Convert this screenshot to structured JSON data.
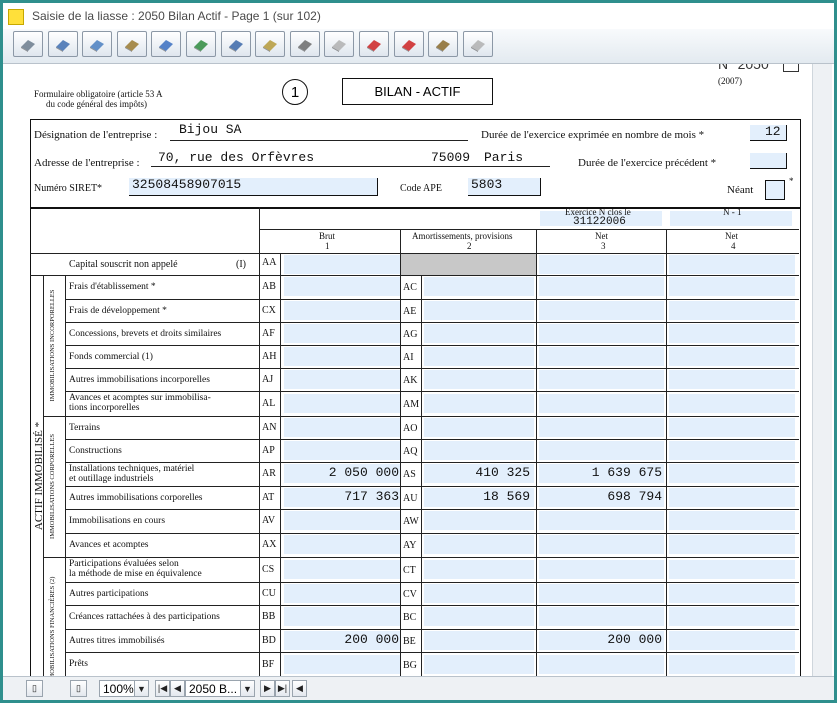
{
  "window": {
    "title": "Saisie de la liasse : 2050  Bilan Actif - Page 1 (sur 102)"
  },
  "toolbar": {
    "buttons": [
      {
        "name": "book-icon"
      },
      {
        "name": "pen-icon"
      },
      {
        "name": "search-people-icon"
      },
      {
        "name": "edit-icon"
      },
      {
        "name": "search-icon"
      },
      {
        "name": "check-icon"
      },
      {
        "name": "print-icon"
      },
      {
        "name": "open-book-icon"
      },
      {
        "name": "stack-icon"
      },
      {
        "name": "disabled-stack-icon"
      },
      {
        "name": "red-folder-icon"
      },
      {
        "name": "red-refresh-icon"
      },
      {
        "name": "printer-icon"
      },
      {
        "name": "disabled-tool-icon"
      }
    ]
  },
  "form": {
    "number_label": "N° 2050",
    "year": "(2007)",
    "note": "Formulaire obligatoire (article 53 A",
    "note2": "du code général des impôts)",
    "circle_number": "1",
    "title": "BILAN - ACTIF",
    "designation_label": "Désignation de l'entreprise :",
    "designation_value": "Bijou SA",
    "duree_label": "Durée de l'exercice exprimée en nombre de mois *",
    "duree_value": "12",
    "adresse_label": "Adresse de l'entreprise :",
    "adresse_value": "70, rue des Orfèvres",
    "cp_value": "75009",
    "ville_value": "Paris",
    "duree_prec_label": "Durée de l'exercice précédent *",
    "siret_label": "Numéro SIRET*",
    "siret_value": "32508458907015",
    "ape_label": "Code APE",
    "ape_value": "5803",
    "neant_label": "Néant",
    "neant_star": "*"
  },
  "table": {
    "exercice_label": "Exercice N clos le",
    "exercice_date": "31122006",
    "n1_label": "N - 1",
    "col_brut": "Brut",
    "col_brut_n": "1",
    "col_amort": "Amortissements, provisions",
    "col_amort_n": "2",
    "col_net": "Net",
    "col_net_n": "3",
    "col_net1": "Net",
    "col_net1_n": "4",
    "group_main": "ACTIF IMMOBILISÉ *",
    "group_incorp": "IMMOBILISATIONS INCORPORELLES",
    "group_corp": "IMMOBILISATIONS CORPORELLES",
    "group_fin": "IMMOBILISATIONS FINANCIÈRES (2)",
    "capital_label": "Capital souscrit non appelé",
    "capital_note": "(I)",
    "capital_code": "AA",
    "rows": [
      {
        "label": "Frais d'établissement *",
        "label2": "",
        "c1": "AB",
        "c2": "AC",
        "brut": "",
        "amort": "",
        "net": ""
      },
      {
        "label": "Frais de développement *",
        "label2": "",
        "c1": "CX",
        "c2": "AE",
        "brut": "",
        "amort": "",
        "net": ""
      },
      {
        "label": "Concessions, brevets et droits similaires",
        "label2": "",
        "c1": "AF",
        "c2": "AG",
        "brut": "",
        "amort": "",
        "net": ""
      },
      {
        "label": "Fonds commercial (1)",
        "label2": "",
        "c1": "AH",
        "c2": "AI",
        "brut": "",
        "amort": "",
        "net": ""
      },
      {
        "label": "Autres immobilisations incorporelles",
        "label2": "",
        "c1": "AJ",
        "c2": "AK",
        "brut": "",
        "amort": "",
        "net": ""
      },
      {
        "label": "Avances et acomptes sur immobilisa-",
        "label2": "tions incorporelles",
        "c1": "AL",
        "c2": "AM",
        "brut": "",
        "amort": "",
        "net": ""
      },
      {
        "label": "Terrains",
        "label2": "",
        "c1": "AN",
        "c2": "AO",
        "brut": "",
        "amort": "",
        "net": ""
      },
      {
        "label": "Constructions",
        "label2": "",
        "c1": "AP",
        "c2": "AQ",
        "brut": "",
        "amort": "",
        "net": ""
      },
      {
        "label": "Installations techniques, matériel",
        "label2": "et outillage industriels",
        "c1": "AR",
        "c2": "AS",
        "brut": "2 050 000",
        "amort": "410 325",
        "net": "1 639 675"
      },
      {
        "label": "Autres immobilisations corporelles",
        "label2": "",
        "c1": "AT",
        "c2": "AU",
        "brut": "717 363",
        "amort": "18 569",
        "net": "698 794"
      },
      {
        "label": "Immobilisations en cours",
        "label2": "",
        "c1": "AV",
        "c2": "AW",
        "brut": "",
        "amort": "",
        "net": ""
      },
      {
        "label": "Avances et acomptes",
        "label2": "",
        "c1": "AX",
        "c2": "AY",
        "brut": "",
        "amort": "",
        "net": ""
      },
      {
        "label": "Participations évaluées selon",
        "label2": "la méthode de mise en équivalence",
        "c1": "CS",
        "c2": "CT",
        "brut": "",
        "amort": "",
        "net": ""
      },
      {
        "label": "Autres participations",
        "label2": "",
        "c1": "CU",
        "c2": "CV",
        "brut": "",
        "amort": "",
        "net": ""
      },
      {
        "label": "Créances rattachées à des participations",
        "label2": "",
        "c1": "BB",
        "c2": "BC",
        "brut": "",
        "amort": "",
        "net": ""
      },
      {
        "label": "Autres titres immobilisés",
        "label2": "",
        "c1": "BD",
        "c2": "BE",
        "brut": "200 000",
        "amort": "",
        "net": "200 000"
      },
      {
        "label": "Prêts",
        "label2": "",
        "c1": "BF",
        "c2": "BG",
        "brut": "",
        "amort": "",
        "net": ""
      }
    ]
  },
  "status": {
    "zoom": "100%",
    "page": "2050 B..."
  }
}
